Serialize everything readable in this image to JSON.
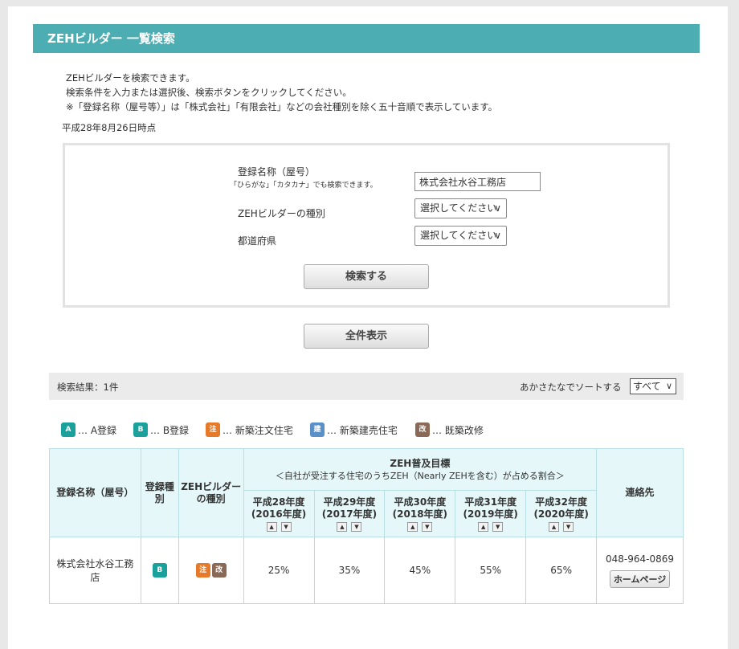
{
  "header": {
    "title": "ZEHビルダー 一覧検索"
  },
  "intro": {
    "line1": "ZEHビルダーを検索できます。",
    "line2": "検索条件を入力または選択後、検索ボタンをクリックしてください。",
    "line3": "※「登録名称（屋号等）」は「株式会社」「有限会社」などの会社種別を除く五十音順で表示しています。"
  },
  "as_of": "平成28年8月26日時点",
  "search": {
    "name_label": "登録名称（屋号）",
    "name_hint": "「ひらがな」「カタカナ」でも検索できます。",
    "name_value": "株式会社水谷工務店",
    "type_label": "ZEHビルダーの種別",
    "type_selected": "選択してください",
    "pref_label": "都道府県",
    "pref_selected": "選択してください",
    "search_button": "検索する",
    "show_all_button": "全件表示"
  },
  "results": {
    "count_text": "検索結果：1件",
    "sort_label": "あかさたなでソートする",
    "sort_selected": "すべて"
  },
  "legend": [
    {
      "badge": "A",
      "text": "… A登録",
      "color": "#1ba19b"
    },
    {
      "badge": "B",
      "text": "… B登録",
      "color": "#1ba19b"
    },
    {
      "badge": "注",
      "text": "… 新築注文住宅",
      "color": "#e67a2a"
    },
    {
      "badge": "建",
      "text": "… 新築建売住宅",
      "color": "#5a8fc7"
    },
    {
      "badge": "改",
      "text": "… 既築改修",
      "color": "#8a6a56"
    }
  ],
  "table": {
    "col_name": "登録名称（屋号）",
    "col_reg": "登録種別",
    "col_type": "ZEHビルダーの種別",
    "col_target_title": "ZEH普及目標",
    "col_target_sub": "＜自社が受注する住宅のうちZEH（Nearly ZEHを含む）が占める割合＞",
    "years": [
      {
        "line1": "平成28年度",
        "line2": "(2016年度)"
      },
      {
        "line1": "平成29年度",
        "line2": "(2017年度)"
      },
      {
        "line1": "平成30年度",
        "line2": "(2018年度)"
      },
      {
        "line1": "平成31年度",
        "line2": "(2019年度)"
      },
      {
        "line1": "平成32年度",
        "line2": "(2020年度)"
      }
    ],
    "col_contact": "連絡先",
    "row": {
      "name": "株式会社水谷工務店",
      "reg_badge": "B",
      "type_badges": [
        "注",
        "改"
      ],
      "targets": [
        "25%",
        "35%",
        "45%",
        "55%",
        "65%"
      ],
      "phone": "048-964-0869",
      "homepage": "ホームページ"
    }
  },
  "colors": {
    "title_bar": "#4caeb3",
    "badge_teal": "#1ba19b",
    "badge_orange": "#e67a2a",
    "badge_blue": "#5a8fc7",
    "badge_brown": "#8a6a56"
  }
}
